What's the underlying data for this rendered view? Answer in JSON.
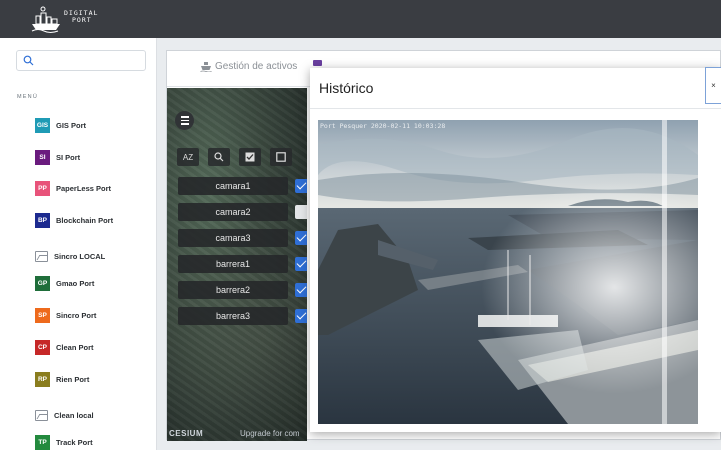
{
  "app": {
    "logo_line1": "DIGITAL",
    "logo_line2": "PORT"
  },
  "sidebar": {
    "search_placeholder": "",
    "menu_label": "MENÚ",
    "items": [
      {
        "badge": "GIS",
        "label": "GIS Port",
        "color": "#1f9bb5",
        "icon": "badge"
      },
      {
        "badge": "SI",
        "label": "SI Port",
        "color": "#6a1b7e",
        "icon": "badge"
      },
      {
        "badge": "PP",
        "label": "PaperLess Port",
        "color": "#e8537a",
        "icon": "badge"
      },
      {
        "badge": "BP",
        "label": "Blockchain Port",
        "color": "#1c2a8f",
        "icon": "badge"
      },
      {
        "badge": "",
        "label": "Sincro LOCAL",
        "color": "",
        "icon": "image-icon"
      },
      {
        "badge": "GP",
        "label": "Gmao Port",
        "color": "#1f6e3a",
        "icon": "badge"
      },
      {
        "badge": "SP",
        "label": "Sincro Port",
        "color": "#ee6a1c",
        "icon": "badge"
      },
      {
        "badge": "CP",
        "label": "Clean Port",
        "color": "#c62828",
        "icon": "badge"
      },
      {
        "badge": "RP",
        "label": "Rien Port",
        "color": "#8a7d1e",
        "icon": "badge"
      },
      {
        "badge": "",
        "label": "Clean local",
        "color": "",
        "icon": "image-icon"
      },
      {
        "badge": "TP",
        "label": "Track Port",
        "color": "#238a3e",
        "icon": "badge"
      }
    ]
  },
  "main": {
    "tabs": [
      {
        "label": "Gestión de activos",
        "icon": "ship-icon"
      }
    ],
    "map": {
      "toolbar": [
        "sort-az-icon",
        "search-icon",
        "check-all-icon",
        "uncheck-all-icon"
      ],
      "sort_label": "AZ",
      "layers": [
        {
          "name": "camara1",
          "checked": true
        },
        {
          "name": "camara2",
          "checked": false
        },
        {
          "name": "camara3",
          "checked": true
        },
        {
          "name": "barrera1",
          "checked": true
        },
        {
          "name": "barrera2",
          "checked": true
        },
        {
          "name": "barrera3",
          "checked": true
        }
      ],
      "cesium_label": "CESIUM",
      "upgrade_text": "Upgrade for com"
    }
  },
  "modal": {
    "title": "Histórico",
    "close_label": "×",
    "camera_label": "Port Pesquer 2020-02-11 10:03:28"
  }
}
